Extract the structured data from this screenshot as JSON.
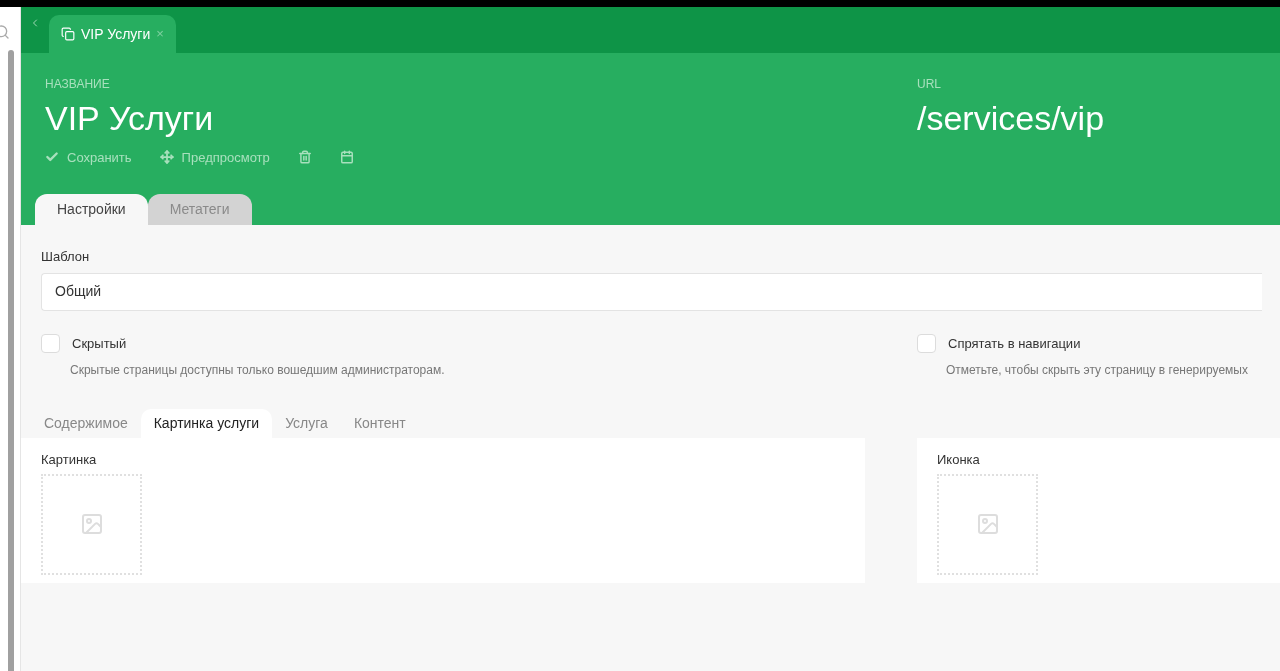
{
  "doc_tab": {
    "label": "VIP Услуги",
    "close": "×"
  },
  "header": {
    "name_label": "НАЗВАНИЕ",
    "name": "VIP Услуги",
    "url_label": "URL",
    "url": "/services/vip"
  },
  "toolbar": [
    {
      "kind": "save",
      "label": "Сохранить"
    },
    {
      "kind": "preview",
      "label": "Предпросмотр"
    },
    {
      "kind": "delete"
    },
    {
      "kind": "calendar"
    }
  ],
  "tabs": [
    {
      "label": "Настройки",
      "selected": true
    },
    {
      "label": "Метатеги",
      "selected": false
    }
  ],
  "template": {
    "label": "Шаблон",
    "value": "Общий"
  },
  "checkboxes": [
    {
      "label": "Скрытый",
      "hint": "Скрытые страницы доступны только вошедшим администраторам.",
      "checked": false
    },
    {
      "label": "Спрятать в навигации",
      "hint": "Отметьте, чтобы скрыть эту страницу в генерируемых",
      "checked": false
    }
  ],
  "content_tabs": [
    {
      "label": "Содержимое",
      "selected": false
    },
    {
      "label": "Картинка услуги",
      "selected": true
    },
    {
      "label": "Услуга",
      "selected": false
    },
    {
      "label": "Контент",
      "selected": false
    }
  ],
  "image_fields": [
    {
      "label": "Картинка"
    },
    {
      "label": "Иконка"
    }
  ]
}
